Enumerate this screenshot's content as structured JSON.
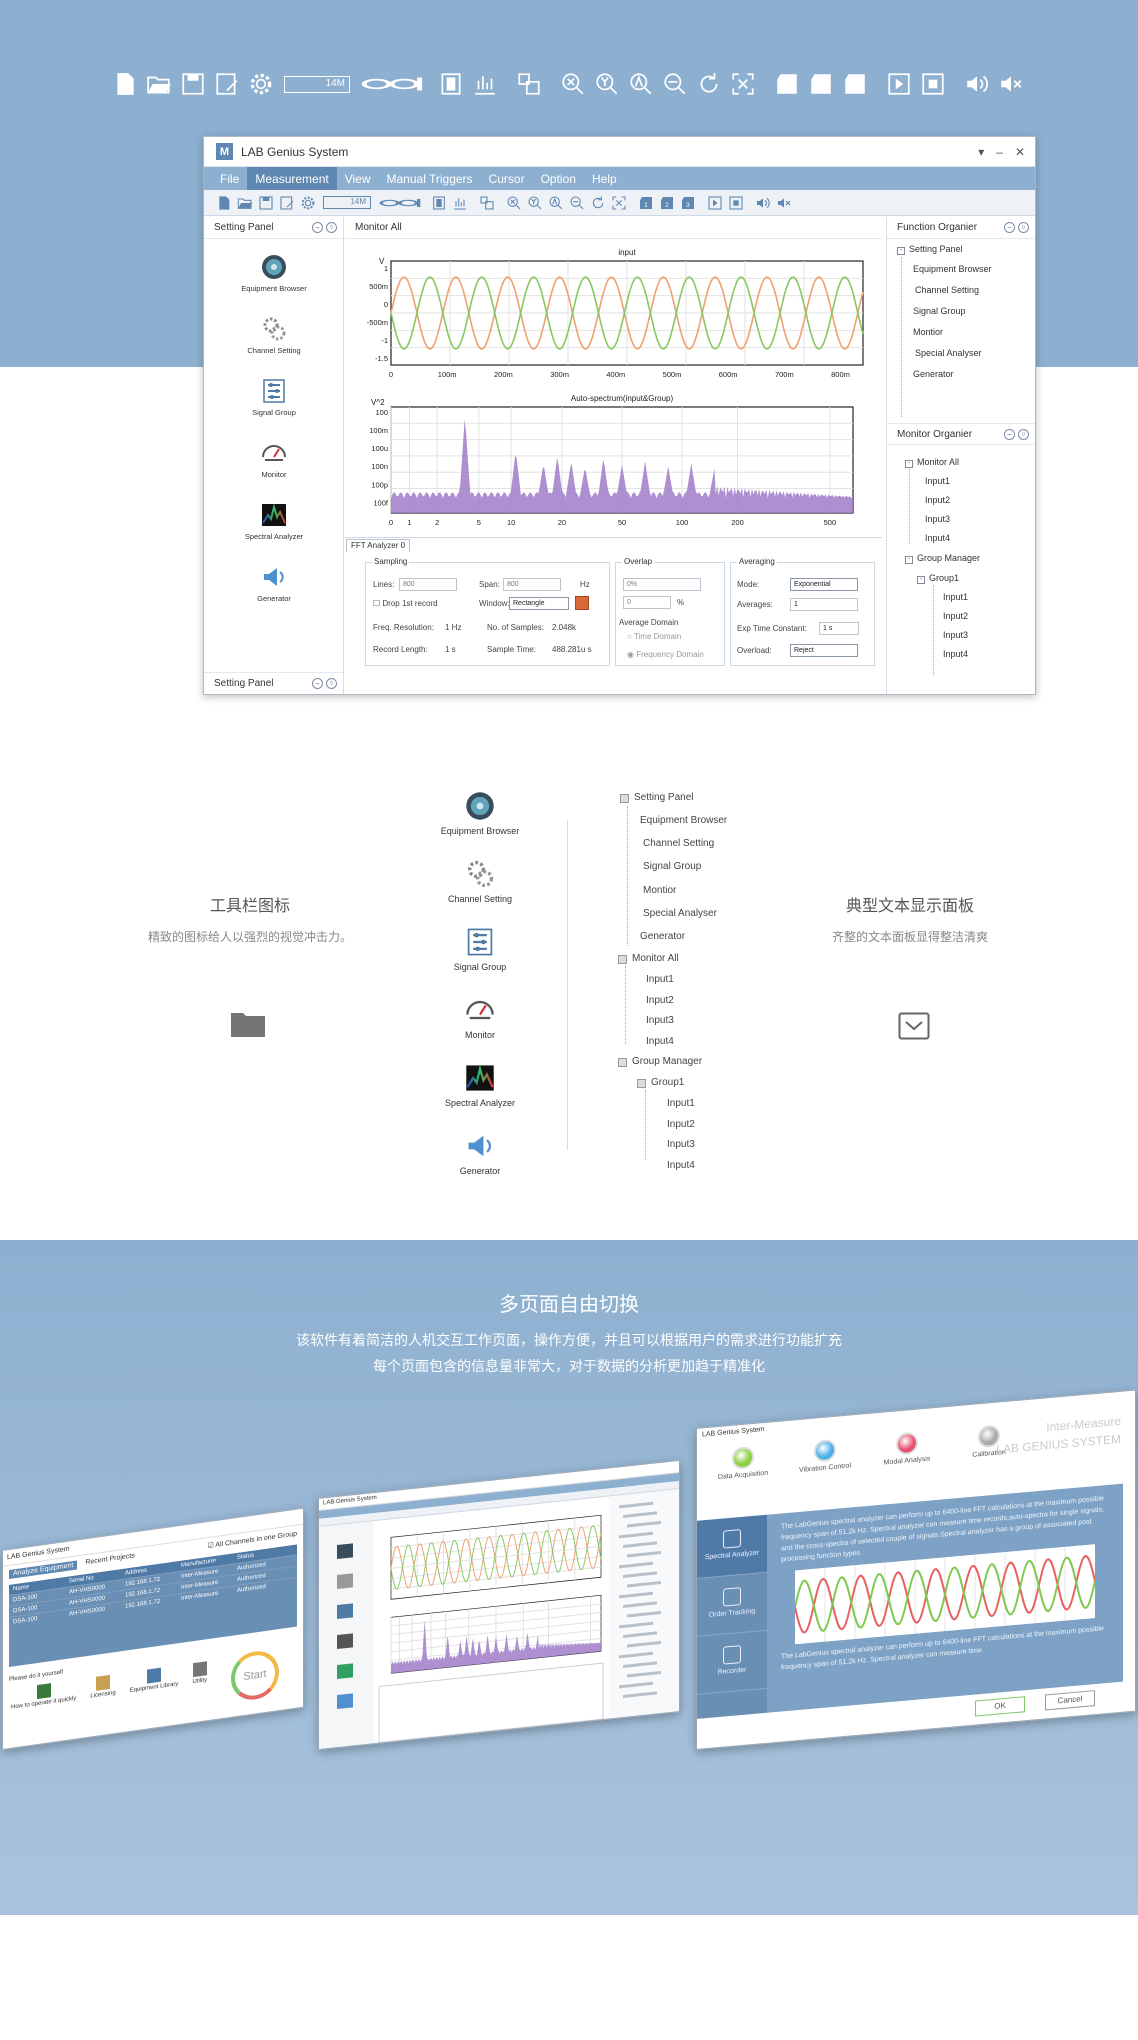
{
  "app": {
    "title": "LAB Genius System",
    "menu": [
      "File",
      "Measurement",
      "View",
      "Manual Triggers",
      "Cursor",
      "Option",
      "Help"
    ],
    "active_menu": "Measurement",
    "toolbar_size_label": "14M"
  },
  "left_panel": {
    "title": "Setting Panel",
    "footer": "Setting Panel",
    "items": [
      "Equipment Browser",
      "Channel Setting",
      "Signal Group",
      "Monitor",
      "Spectral Analyzer",
      "Generator"
    ]
  },
  "main": {
    "title": "Monitor All",
    "tab": "FFT Analyzer 0",
    "sampling": {
      "legend": "Sampling",
      "lines_label": "Lines:",
      "lines_value": "800",
      "span_label": "Span:",
      "span_value": "800",
      "span_unit": "Hz",
      "drop_label": "Drop 1st record",
      "window_label": "Window:",
      "window_value": "Rectangle",
      "freq_res_label": "Freq. Resolution:",
      "freq_res_value": "1 Hz",
      "samples_label": "No. of Samples:",
      "samples_value": "2.048k",
      "record_label": "Record Length:",
      "record_value": "1 s",
      "sample_time_label": "Sample Time:",
      "sample_time_value": "488.281u s"
    },
    "overlap": {
      "legend": "Overlap",
      "value": "0%",
      "input": "0",
      "unit": "%",
      "domain_legend": "Average Domain",
      "time": "Time Domain",
      "freq": "Frequency Domain"
    },
    "averaging": {
      "legend": "Averaging",
      "mode_label": "Mode:",
      "mode_value": "Exponential",
      "avg_label": "Averages:",
      "avg_value": "1",
      "exp_label": "Exp Time Constant:",
      "exp_value": "1 s",
      "overload_label": "Overload:",
      "overload_value": "Reject"
    }
  },
  "function_organizer": {
    "title": "Function Organier",
    "root": "Setting Panel",
    "items": [
      "Equipment Browser",
      "Channel Setting",
      "Signal Group",
      "Montior",
      "Special Analyser",
      "Generator"
    ]
  },
  "monitor_organizer": {
    "title": "Monitor Organier",
    "root": "Monitor All",
    "inputs": [
      "Input1",
      "Input2",
      "Input3",
      "Input4"
    ],
    "group_manager": "Group Manager",
    "group": "Group1",
    "group_inputs": [
      "Input1",
      "Input2",
      "Input3",
      "Input4"
    ]
  },
  "chart_data": [
    {
      "type": "line",
      "title": "input",
      "ylabel": "V",
      "x_ticks": [
        "0",
        "100m",
        "200m",
        "300m",
        "400m",
        "500m",
        "600m",
        "700m",
        "800m"
      ],
      "y_ticks": [
        "1",
        "500m",
        "0",
        "-500m",
        "-1",
        "-1.5"
      ],
      "xlim": [
        0,
        0.84
      ],
      "ylim": [
        -1.7,
        1.2
      ],
      "series": [
        {
          "color": "#f0a070",
          "amplitude": 1.0,
          "cycles": 9.1,
          "phase": 0
        },
        {
          "color": "#88c860",
          "amplitude": 1.0,
          "cycles": 9.1,
          "phase": 3.14
        }
      ]
    },
    {
      "type": "area",
      "title": "Auto-spectrum(input&Group)",
      "ylabel": "V^2",
      "x_ticks": [
        "0",
        "1",
        "2",
        "5",
        "10",
        "20",
        "50",
        "100",
        "200",
        "500"
      ],
      "y_ticks": [
        "100",
        "100m",
        "100u",
        "100n",
        "100p",
        "100f"
      ],
      "xscale": "log",
      "color": "#a07cc8"
    }
  ],
  "features": {
    "toolbar_heading": "工具栏图标",
    "toolbar_desc": "精致的图标给人以强烈的视觉冲击力。",
    "text_heading": "典型文本显示面板",
    "text_desc": "齐整的文本面板显得整洁清爽",
    "icons": [
      "Equipment Browser",
      "Channel Setting",
      "Signal Group",
      "Monitor",
      "Spectral Analyzer",
      "Generator"
    ],
    "tree_setting": [
      "Setting Panel",
      "Equipment Browser",
      "Channel Setting",
      "Signal Group",
      "Montior",
      "Special Analyser",
      "Generator"
    ],
    "tree_monitor": [
      "Monitor All",
      "Input1",
      "Input2",
      "Input3",
      "Input4"
    ],
    "tree_group": [
      "Group Manager",
      "Group1",
      "Input1",
      "Input2",
      "Input3",
      "Input4"
    ]
  },
  "switching": {
    "heading": "多页面自由切换",
    "line1": "该软件有着简洁的人机交互工作页面，操作方便，并且可以根据用户的需求进行功能扩充",
    "line2": "每个页面包含的信息量非常大，对于数据的分析更加趋于精准化"
  },
  "mini1": {
    "tabs": [
      "Analyze Equipment",
      "Recent Projects"
    ],
    "checkbox": "All Channels in one Group",
    "cols": [
      "Name",
      "Serial No",
      "Address",
      "Manufacturer",
      "Status"
    ],
    "rows": [
      [
        "DSA-100",
        "AH-VHS0000",
        "192.168.1.72",
        "Inter-Measure",
        "Authorized"
      ],
      [
        "DSA-100",
        "AH-VHS0000",
        "192.168.1.72",
        "Inter-Measure",
        "Authorized"
      ],
      [
        "DSA-100",
        "AH-VHS0000",
        "192.168.1.72",
        "Inter-Measure",
        "Authorized"
      ]
    ],
    "question": "Please do it yourself",
    "tools": [
      "How to operate it quickly",
      "Licensing",
      "Equipment Library",
      "Utility"
    ],
    "start": "Start"
  },
  "mini3": {
    "brand1": "Inter-Measure",
    "brand2": "LAB GENIUS SYSTEM",
    "modes": [
      "Data Acquisition",
      "Vibration Control",
      "Modal Analysis",
      "Calibration"
    ],
    "side": [
      "Spectral Analyzer",
      "Order Tracking",
      "Recorder"
    ],
    "text1": "The LabGenius spectral analyzer can perform up to 6400-line FFT calculations at the maximum possible frequency span of 51.2k Hz. Spectral analyzer can measure time records,auto-spectra for single signals, and the cross-spectra of selected couple of signals.Spectral analyzer has a group of associated post processing function types",
    "text2": "The LabGenius spectral analyzer can perform up to 6400-line FFT calculations at the maximum possible frequency span of 51.2k Hz. Spectral analyzer can measure time",
    "ok": "OK",
    "cancel": "Cancel"
  }
}
